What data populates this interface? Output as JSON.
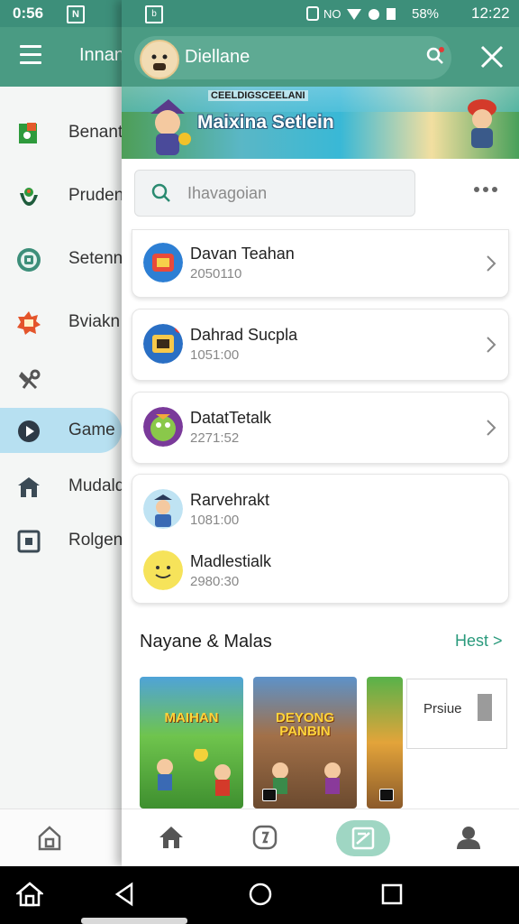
{
  "background_app": {
    "status": {
      "time": "0:56",
      "notif_icon": "N"
    },
    "appbar": {
      "title": "Innan"
    },
    "drawer": [
      {
        "label": "Benant",
        "icon": "book-icon"
      },
      {
        "label": "Pruden",
        "icon": "leaf-icon"
      },
      {
        "label": "Setenn",
        "icon": "settings-icon"
      },
      {
        "label": "Bviakn",
        "icon": "badge-icon"
      },
      {
        "label": "",
        "icon": "tools-icon"
      },
      {
        "label": "Game",
        "icon": "play-icon",
        "active": true
      },
      {
        "label": "Mudald",
        "icon": "store-icon"
      },
      {
        "label": "Rolgen",
        "icon": "square-icon"
      }
    ]
  },
  "status": {
    "app_icon": "b",
    "battery_pct": "58%",
    "time": "12:22"
  },
  "header": {
    "user_name": "Diellane"
  },
  "banner": {
    "small_text": "CEELDIGSCEELANI",
    "title": "Maixina Setlein"
  },
  "search": {
    "placeholder": "Ihavagoian"
  },
  "chats": [
    {
      "name": "Davan Teahan",
      "time": "2050110"
    },
    {
      "name": "Dahrad Sucpla",
      "time": "1051:00"
    },
    {
      "name": "DatatTetalk",
      "time": "2271:52"
    },
    {
      "name": "Rarvehrakt",
      "time": "1081:00"
    },
    {
      "name": "Madlestialk",
      "time": "2980:30"
    }
  ],
  "section": {
    "title": "Nayane & Malas",
    "link": "Hest >"
  },
  "tiles": [
    {
      "name": "MAIHAN"
    },
    {
      "name": "DEYONG PANBIN"
    },
    {
      "name": ""
    }
  ],
  "overlay": {
    "text": "Prsiue"
  },
  "colors": {
    "primary": "#4a9b83",
    "status": "#3d8f7a",
    "accent": "#2a9a7c",
    "active_nav": "#9fd6c3",
    "drawer_active": "#b7e0f1"
  }
}
